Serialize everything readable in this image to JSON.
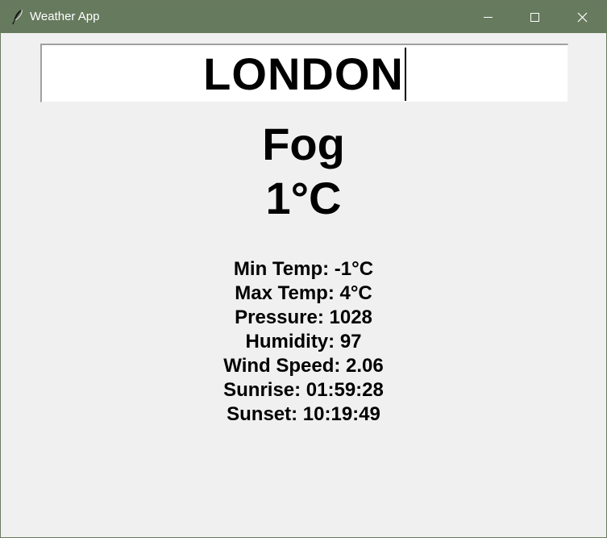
{
  "window": {
    "title": "Weather App",
    "icon": "feather-icon",
    "titlebar_color": "#667a5e"
  },
  "search": {
    "value": "LONDON"
  },
  "weather": {
    "condition": "Fog",
    "temperature": "1°C"
  },
  "details": [
    "Min Temp: -1°C",
    "Max Temp: 4°C",
    "Pressure: 1028",
    "Humidity: 97",
    "Wind Speed: 2.06",
    "Sunrise: 01:59:28",
    "Sunset: 10:19:49"
  ]
}
